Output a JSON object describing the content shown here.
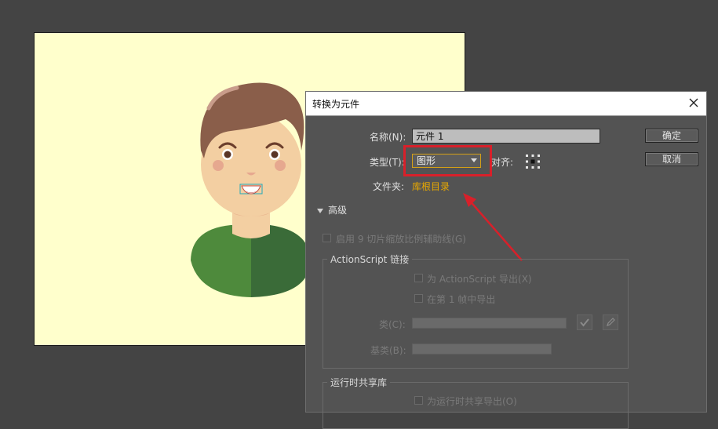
{
  "dialog": {
    "title": "转换为元件",
    "name_label": "名称(N):",
    "name_value": "元件 1",
    "type_label": "类型(T):",
    "type_value": "图形",
    "align_label": "对齐:",
    "folder_label": "文件夹:",
    "folder_value": "库根目录",
    "ok_label": "确定",
    "cancel_label": "取消",
    "advanced_label": "高级",
    "nine_slice_label": "启用 9 切片缩放比例辅助线(G)",
    "actionscript": {
      "group_title": "ActionScript 链接",
      "export_as_label": "为 ActionScript 导出(X)",
      "export_frame_label": "在第 1 帧中导出",
      "class_label": "类(C):",
      "base_class_label": "基类(B):"
    },
    "runtime": {
      "group_title": "运行时共享库",
      "export_label": "为运行时共享导出(O)"
    }
  },
  "colors": {
    "stage_bg": "#ffffcc",
    "highlight": "#d8202a",
    "folder_link": "#e8a800",
    "hair": "#8a5e4a",
    "skin": "#f3cfa2",
    "shirt_light": "#4e8a3c",
    "shirt_dark": "#3a6b38"
  }
}
